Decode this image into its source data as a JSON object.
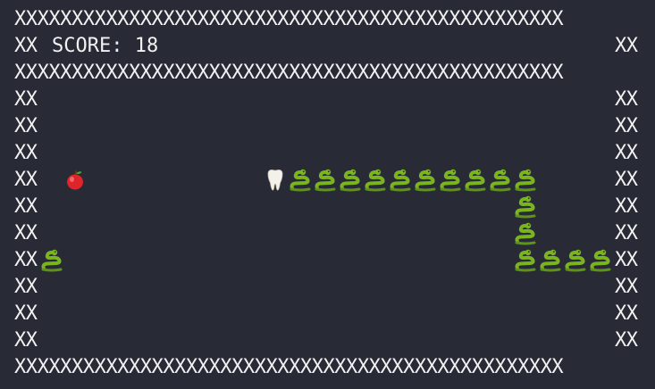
{
  "board": {
    "top_border": "XXXXXXXXXXXXXXXXXXXXXXXXXXXXXXXXXXXXXXXXXXXXXXXX",
    "mid_border": "XXXXXXXXXXXXXXXXXXXXXXXXXXXXXXXXXXXXXXXXXXXXXXXX",
    "bottom_border": "XXXXXXXXXXXXXXXXXXXXXXXXXXXXXXXXXXXXXXXXXXXXXXXX",
    "wall_segment": "XX"
  },
  "score": {
    "text": "SCORE: 18"
  },
  "game": {
    "apple_icon": "red-apple",
    "head_icon": "tooth",
    "body_icon": "snake"
  },
  "colors": {
    "background": "#282a36",
    "text": "#f2f2f2",
    "snake_green": "#7ab51d",
    "apple_red": "#e0242b"
  }
}
